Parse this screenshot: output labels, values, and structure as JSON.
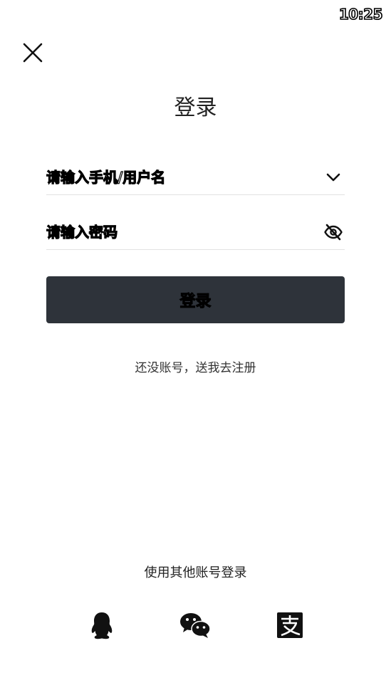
{
  "status_bar": {
    "time": "10:25"
  },
  "header": {
    "title": "登录"
  },
  "form": {
    "username_placeholder": "请输入手机/用户名",
    "password_placeholder": "请输入密码",
    "login_label": "登录"
  },
  "register": {
    "link_text": "还没账号，送我去注册"
  },
  "other_login": {
    "label": "使用其他账号登录",
    "providers": [
      "qq-icon",
      "wechat-icon",
      "alipay-icon"
    ]
  },
  "colors": {
    "button_bg": "#2e333a",
    "divider": "#e2e2e2"
  }
}
